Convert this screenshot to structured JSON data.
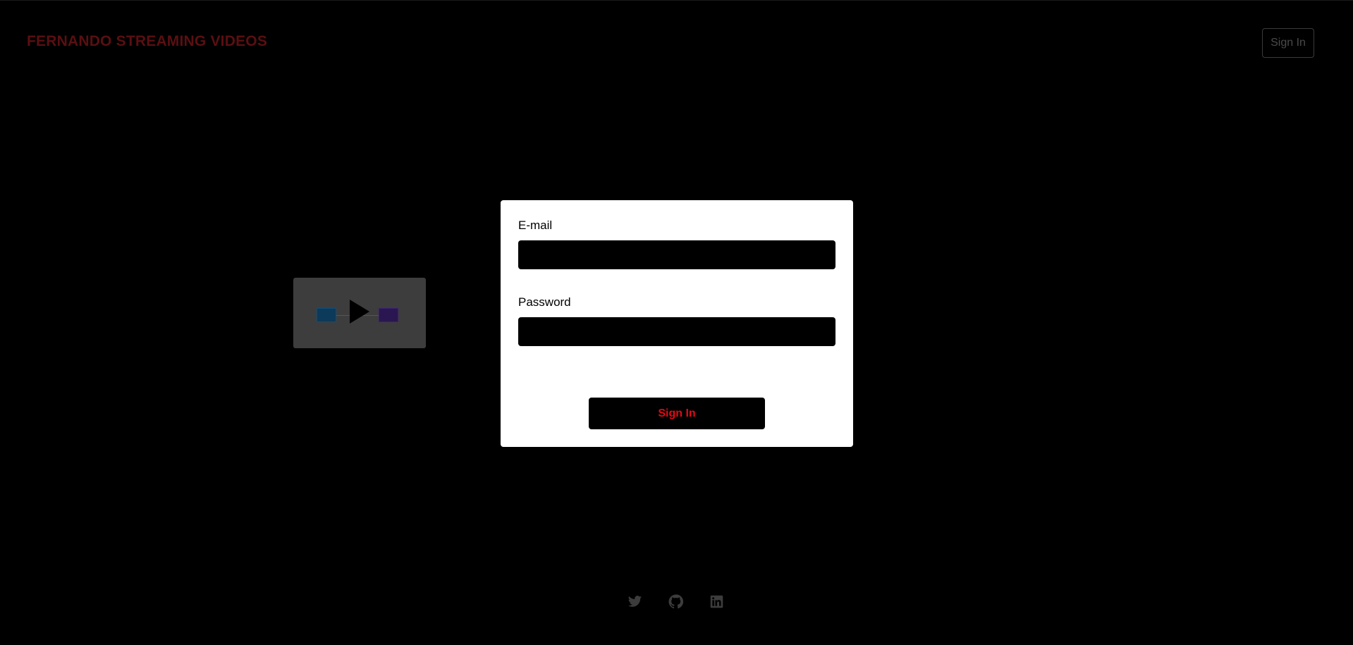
{
  "header": {
    "brand": "FERNANDO STREAMING VIDEOS",
    "signin_label": "Sign In"
  },
  "video": {
    "thumbnail_icon": "play-icon"
  },
  "login": {
    "email_label": "E-mail",
    "email_value": "",
    "password_label": "Password",
    "password_value": "",
    "signin_label": "Sign In"
  },
  "footer": {
    "icons": [
      "twitter-icon",
      "github-icon",
      "linkedin-icon"
    ]
  },
  "colors": {
    "background": "#000000",
    "brand": "#5a0f12",
    "accent": "#e50914",
    "modal": "#ffffff"
  }
}
